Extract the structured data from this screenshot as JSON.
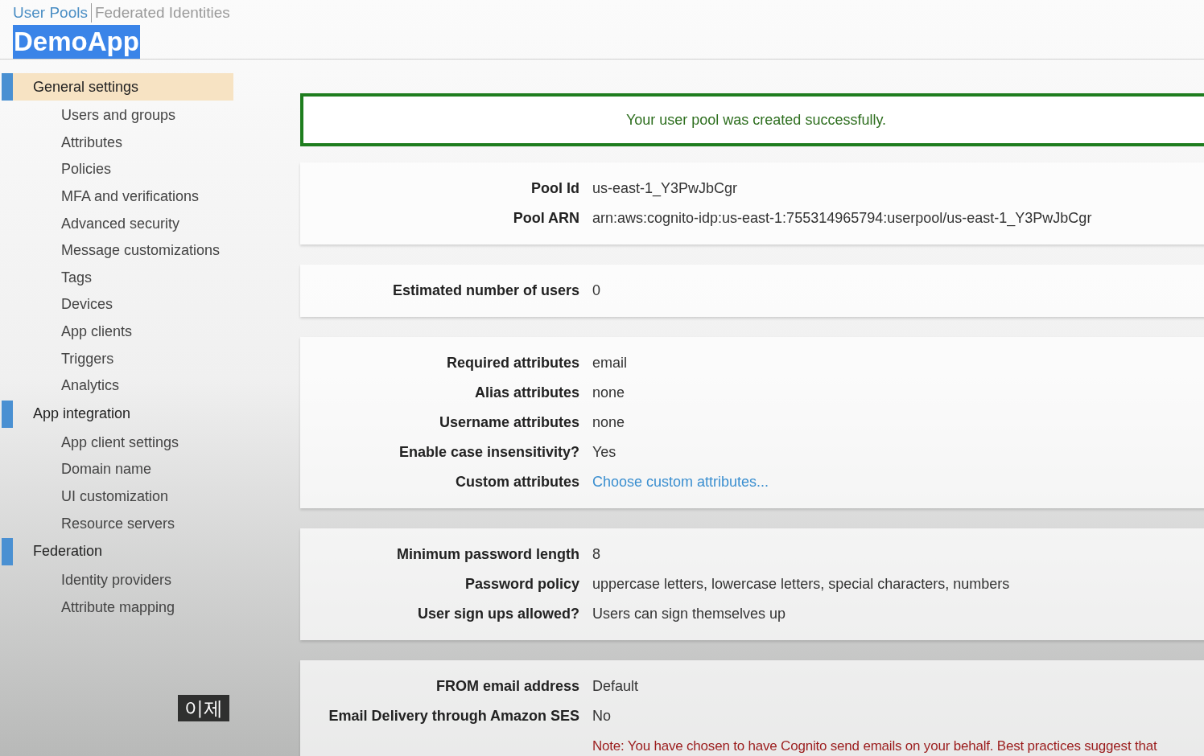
{
  "header": {
    "tabs": [
      {
        "label": "User Pools",
        "selected": true
      },
      {
        "label": "Federated Identities",
        "selected": false
      }
    ],
    "title": "DemoApp",
    "title_selected": true
  },
  "sidebar": {
    "sections": [
      {
        "label": "General settings",
        "selected": true,
        "children": [
          {
            "label": "Users and groups",
            "selected": false
          },
          {
            "label": "Attributes",
            "selected": false
          },
          {
            "label": "Policies",
            "selected": false
          },
          {
            "label": "MFA and verifications",
            "selected": false
          },
          {
            "label": "Advanced security",
            "selected": false
          },
          {
            "label": "Message customizations",
            "selected": false
          },
          {
            "label": "Tags",
            "selected": false
          },
          {
            "label": "Devices",
            "selected": false
          },
          {
            "label": "App clients",
            "selected": false
          },
          {
            "label": "Triggers",
            "selected": false
          },
          {
            "label": "Analytics",
            "selected": false
          }
        ]
      },
      {
        "label": "App integration",
        "selected": false,
        "children": [
          {
            "label": "App client settings",
            "selected": false
          },
          {
            "label": "Domain name",
            "selected": false
          },
          {
            "label": "UI customization",
            "selected": false
          },
          {
            "label": "Resource servers",
            "selected": false
          }
        ]
      },
      {
        "label": "Federation",
        "selected": false,
        "children": [
          {
            "label": "Identity providers",
            "selected": false
          },
          {
            "label": "Attribute mapping",
            "selected": false
          }
        ]
      }
    ]
  },
  "banner": {
    "message": "Your user pool was created successfully."
  },
  "cards": [
    {
      "rows": [
        {
          "label": "Pool Id",
          "value": "us-east-1_Y3PwJbCgr",
          "kind": "text"
        },
        {
          "label": "Pool ARN",
          "value": "arn:aws:cognito-idp:us-east-1:755314965794:userpool/us-east-1_Y3PwJbCgr",
          "kind": "text"
        }
      ]
    },
    {
      "rows": [
        {
          "label": "Estimated number of users",
          "value": "0",
          "kind": "text"
        }
      ]
    },
    {
      "rows": [
        {
          "label": "Required attributes",
          "value": "email",
          "kind": "text"
        },
        {
          "label": "Alias attributes",
          "value": "none",
          "kind": "text"
        },
        {
          "label": "Username attributes",
          "value": "none",
          "kind": "text"
        },
        {
          "label": "Enable case insensitivity?",
          "value": "Yes",
          "kind": "text"
        },
        {
          "label": "Custom attributes",
          "value": "Choose custom attributes...",
          "kind": "link"
        }
      ]
    },
    {
      "rows": [
        {
          "label": "Minimum password length",
          "value": "8",
          "kind": "text"
        },
        {
          "label": "Password policy",
          "value": "uppercase letters, lowercase letters, special characters, numbers",
          "kind": "text"
        },
        {
          "label": "User sign ups allowed?",
          "value": "Users can sign themselves up",
          "kind": "text"
        }
      ]
    },
    {
      "rows": [
        {
          "label": "FROM email address",
          "value": "Default",
          "kind": "text"
        },
        {
          "label": "Email Delivery through Amazon SES",
          "value": "No",
          "kind": "text"
        },
        {
          "label": "",
          "value": "Note: You have chosen to have Cognito send emails on your behalf. Best practices suggest that",
          "kind": "note"
        }
      ]
    }
  ],
  "caption": "이제"
}
